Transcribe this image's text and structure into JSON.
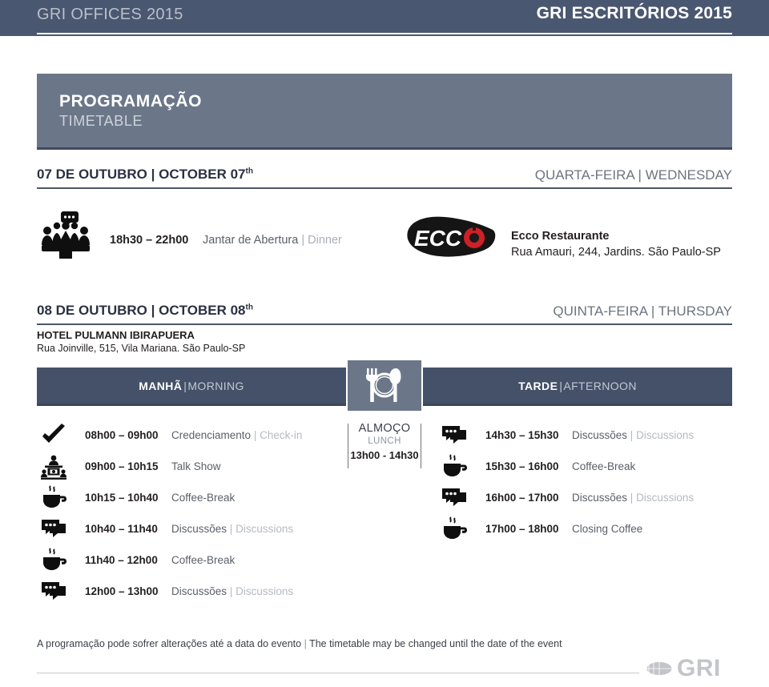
{
  "header": {
    "left_title": "GRI OFFICES 2015",
    "right_title": "GRI ESCRITÓRIOS 2015"
  },
  "title_banner": {
    "title_pt": "PROGRAMAÇÃO",
    "title_en": "TIMETABLE"
  },
  "colors": {
    "header_band": "#4a5770",
    "banner": "#6b7789",
    "nav_bar": "#445168",
    "text_dark": "#231f20",
    "text_muted": "#5a5f69",
    "text_light": "#b5bac1",
    "ecco_red": "#cf2027",
    "gri_gray": "#c3c5c9"
  },
  "day1": {
    "date_pt": "07 DE OUTUBRO",
    "separator": "|",
    "date_en": "OCTOBER 07",
    "date_en_sup": "th",
    "weekday_pt": "QUARTA-FEIRA",
    "weekday_en": "WEDNESDAY",
    "event": {
      "icon": "group-discussion-icon",
      "time": "18h30 – 22h00",
      "label_pt": "Jantar de Abertura",
      "label_en": "Dinner"
    },
    "venue": {
      "logo": "ecco-logo",
      "logo_text": "ECC",
      "name": "Ecco Restaurante",
      "address": "Rua Amauri, 244, Jardins. São Paulo-SP"
    }
  },
  "day2": {
    "date_pt": "08 DE OUTUBRO",
    "separator": "|",
    "date_en": "OCTOBER 08",
    "date_en_sup": "th",
    "weekday_pt": "QUINTA-FEIRA",
    "weekday_en": "THURSDAY",
    "venue": {
      "name": "HOTEL PULMANN IBIRAPUERA",
      "address": "Rua Joinville, 515, Vila Mariana. São Paulo-SP"
    },
    "morning_bar": {
      "label_pt": "MANHÃ",
      "separator": "|",
      "label_en": "MORNING"
    },
    "afternoon_bar": {
      "label_pt": "TARDE",
      "separator": "|",
      "label_en": "AFTERNOON"
    },
    "lunch": {
      "icon": "cutlery-plate-icon",
      "label_pt": "ALMOÇO",
      "label_en": "LUNCH",
      "time": "13h00 - 14h30"
    },
    "morning_rows": [
      {
        "icon": "check-icon",
        "time": "08h00 – 09h00",
        "label_pt": "Credenciamento",
        "separator": "|",
        "label_en": "Check-in"
      },
      {
        "icon": "podium-talkshow-icon",
        "time": "09h00 – 10h15",
        "label_pt": "Talk Show",
        "separator": "",
        "label_en": ""
      },
      {
        "icon": "coffee-cup-icon",
        "time": "10h15 – 10h40",
        "label_pt": "Coffee-Break",
        "separator": "",
        "label_en": ""
      },
      {
        "icon": "speech-bubbles-icon",
        "time": "10h40 – 11h40",
        "label_pt": "Discussões",
        "separator": "|",
        "label_en": "Discussions"
      },
      {
        "icon": "coffee-cup-icon",
        "time": "11h40 – 12h00",
        "label_pt": "Coffee-Break",
        "separator": "",
        "label_en": ""
      },
      {
        "icon": "speech-bubbles-icon",
        "time": "12h00 – 13h00",
        "label_pt": "Discussões",
        "separator": "|",
        "label_en": "Discussions"
      }
    ],
    "afternoon_rows": [
      {
        "icon": "speech-bubbles-icon",
        "time": "14h30 – 15h30",
        "label_pt": "Discussões",
        "separator": "|",
        "label_en": "Discussions"
      },
      {
        "icon": "coffee-cup-icon",
        "time": "15h30 – 16h00",
        "label_pt": "Coffee-Break",
        "separator": "",
        "label_en": ""
      },
      {
        "icon": "speech-bubbles-icon",
        "time": "16h00 – 17h00",
        "label_pt": "Discussões",
        "separator": "|",
        "label_en": "Discussions"
      },
      {
        "icon": "coffee-cup-icon",
        "time": "17h00 – 18h00",
        "label_pt": "Closing Coffee",
        "separator": "",
        "label_en": ""
      }
    ]
  },
  "footer": {
    "note_pt": "A programação pode sofrer alterações até a data do evento",
    "separator": "|",
    "note_en": "The timetable may be changed until the date of the event",
    "logo_text": "GRI"
  }
}
